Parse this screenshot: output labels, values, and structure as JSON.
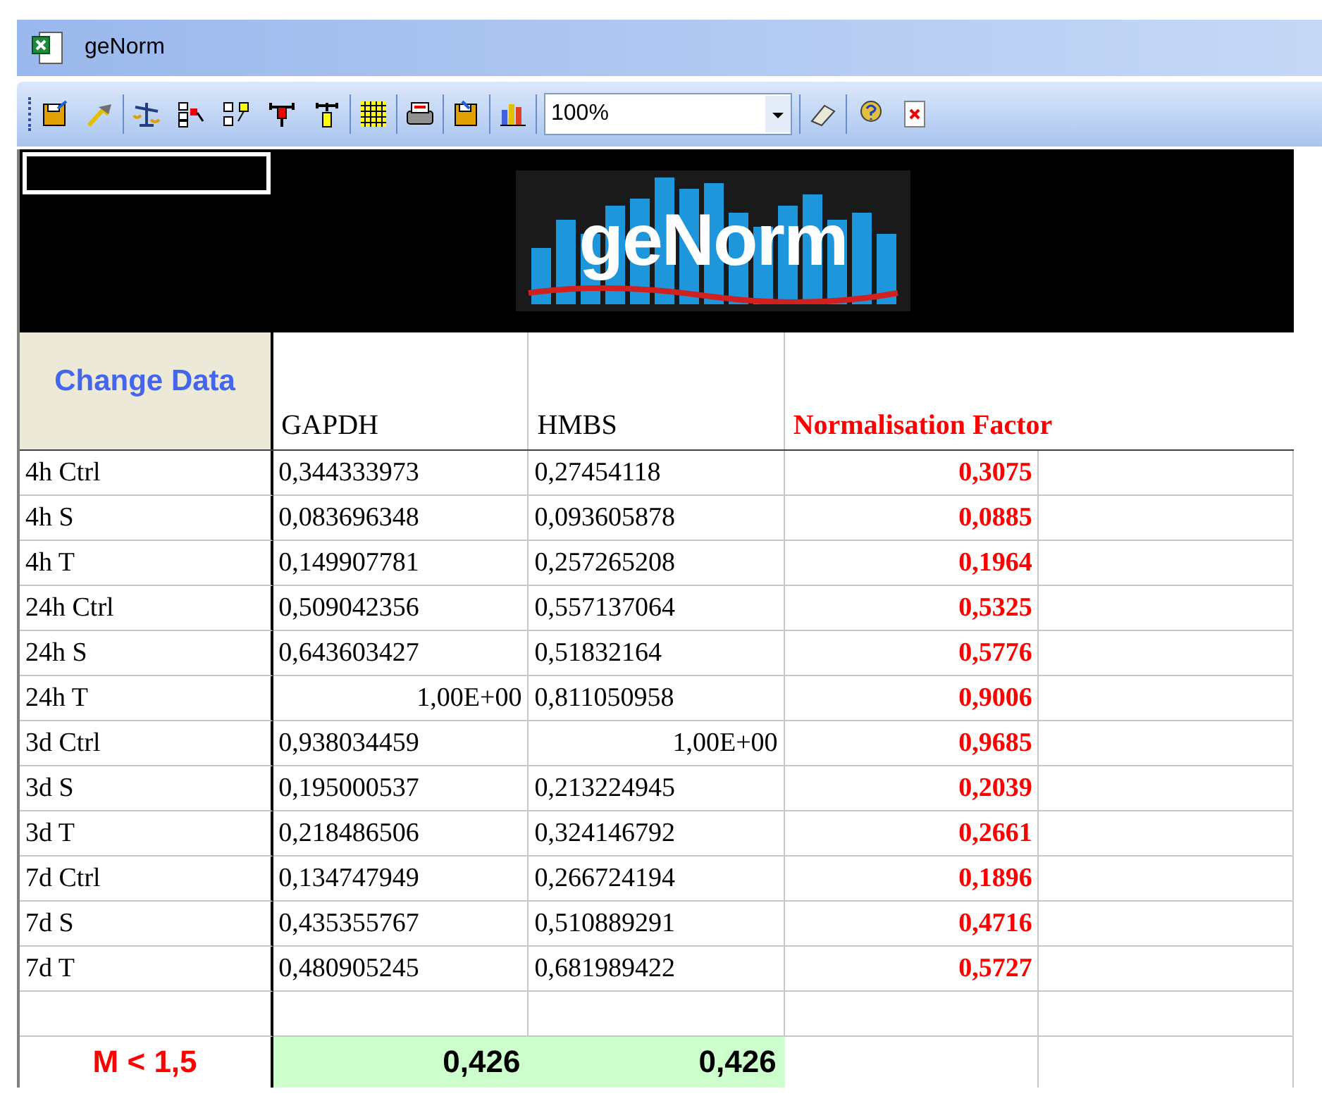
{
  "window": {
    "title": "geNorm"
  },
  "toolbar": {
    "zoom": "100%"
  },
  "logo": {
    "text": "geNorm"
  },
  "sheet": {
    "button": "Change Data",
    "columns": [
      "GAPDH",
      "HMBS",
      "Normalisation Factor"
    ],
    "rows": [
      {
        "label": "4h Ctrl",
        "values": [
          {
            "text": "0,344333973",
            "right_aligned": false
          },
          {
            "text": "0,27454118",
            "right_aligned": false
          }
        ],
        "factor": "0,3075"
      },
      {
        "label": "4h S",
        "values": [
          {
            "text": "0,083696348",
            "right_aligned": false
          },
          {
            "text": "0,093605878",
            "right_aligned": false
          }
        ],
        "factor": "0,0885"
      },
      {
        "label": "4h T",
        "values": [
          {
            "text": "0,149907781",
            "right_aligned": false
          },
          {
            "text": "0,257265208",
            "right_aligned": false
          }
        ],
        "factor": "0,1964"
      },
      {
        "label": "24h Ctrl",
        "values": [
          {
            "text": "0,509042356",
            "right_aligned": false
          },
          {
            "text": "0,557137064",
            "right_aligned": false
          }
        ],
        "factor": "0,5325"
      },
      {
        "label": "24h S",
        "values": [
          {
            "text": "0,643603427",
            "right_aligned": false
          },
          {
            "text": "0,51832164",
            "right_aligned": false
          }
        ],
        "factor": "0,5776"
      },
      {
        "label": "24h T",
        "values": [
          {
            "text": "1,00E+00",
            "right_aligned": true
          },
          {
            "text": "0,811050958",
            "right_aligned": false
          }
        ],
        "factor": "0,9006"
      },
      {
        "label": "3d Ctrl",
        "values": [
          {
            "text": "0,938034459",
            "right_aligned": false
          },
          {
            "text": "1,00E+00",
            "right_aligned": true
          }
        ],
        "factor": "0,9685"
      },
      {
        "label": "3d S",
        "values": [
          {
            "text": "0,195000537",
            "right_aligned": false
          },
          {
            "text": "0,213224945",
            "right_aligned": false
          }
        ],
        "factor": "0,2039"
      },
      {
        "label": "3d T",
        "values": [
          {
            "text": "0,218486506",
            "right_aligned": false
          },
          {
            "text": "0,324146792",
            "right_aligned": false
          }
        ],
        "factor": "0,2661"
      },
      {
        "label": "7d Ctrl",
        "values": [
          {
            "text": "0,134747949",
            "right_aligned": false
          },
          {
            "text": "0,266724194",
            "right_aligned": false
          }
        ],
        "factor": "0,1896"
      },
      {
        "label": "7d S",
        "values": [
          {
            "text": "0,435355767",
            "right_aligned": false
          },
          {
            "text": "0,510889291",
            "right_aligned": false
          }
        ],
        "factor": "0,4716"
      },
      {
        "label": "7d T",
        "values": [
          {
            "text": "0,480905245",
            "right_aligned": false
          },
          {
            "text": "0,681989422",
            "right_aligned": false
          }
        ],
        "factor": "0,5727"
      }
    ],
    "summary": {
      "label": "M < 1,5",
      "values": [
        "0,426",
        "0,426"
      ]
    }
  }
}
